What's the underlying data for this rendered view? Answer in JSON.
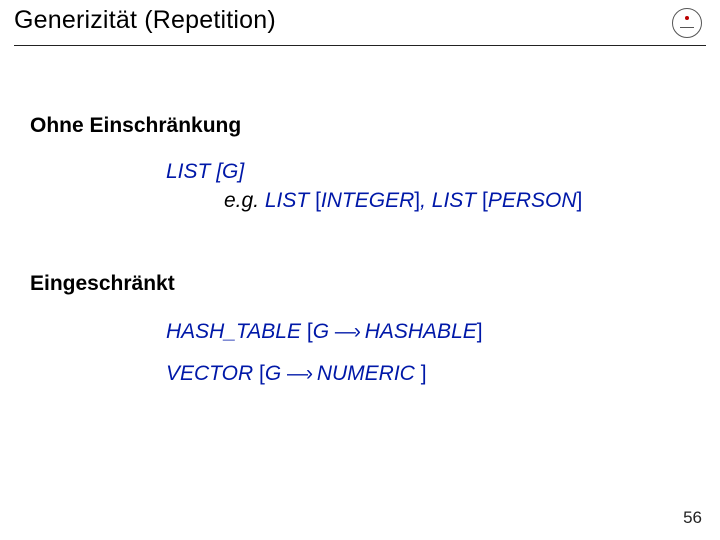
{
  "title": "Generizität (Repetition)",
  "sections": {
    "unconstrained": "Ohne Einschränkung",
    "constrained": "Eingeschränkt"
  },
  "lines": {
    "list": {
      "type": "LIST",
      "lb": "[",
      "param": "G",
      "rb": "]"
    },
    "eg": {
      "prefix": "e.g. ",
      "t1": "LIST",
      "lb1": "[",
      "a1": "INTEGER",
      "rb1": "]",
      "sep": ", ",
      "t2": "LIST",
      "lb2": "[",
      "a2": "PERSON",
      "rb2": "]"
    },
    "hash": {
      "type": "HASH_TABLE",
      "lb": "[",
      "param": "G",
      "arrow": "—›",
      "bound": " HASHABLE",
      "rb": "]"
    },
    "vec": {
      "type": "VECTOR",
      "lb": "[",
      "param": "G",
      "arrow": "—›",
      "bound": " NUMERIC ",
      "rb": "]"
    }
  },
  "page": "56"
}
